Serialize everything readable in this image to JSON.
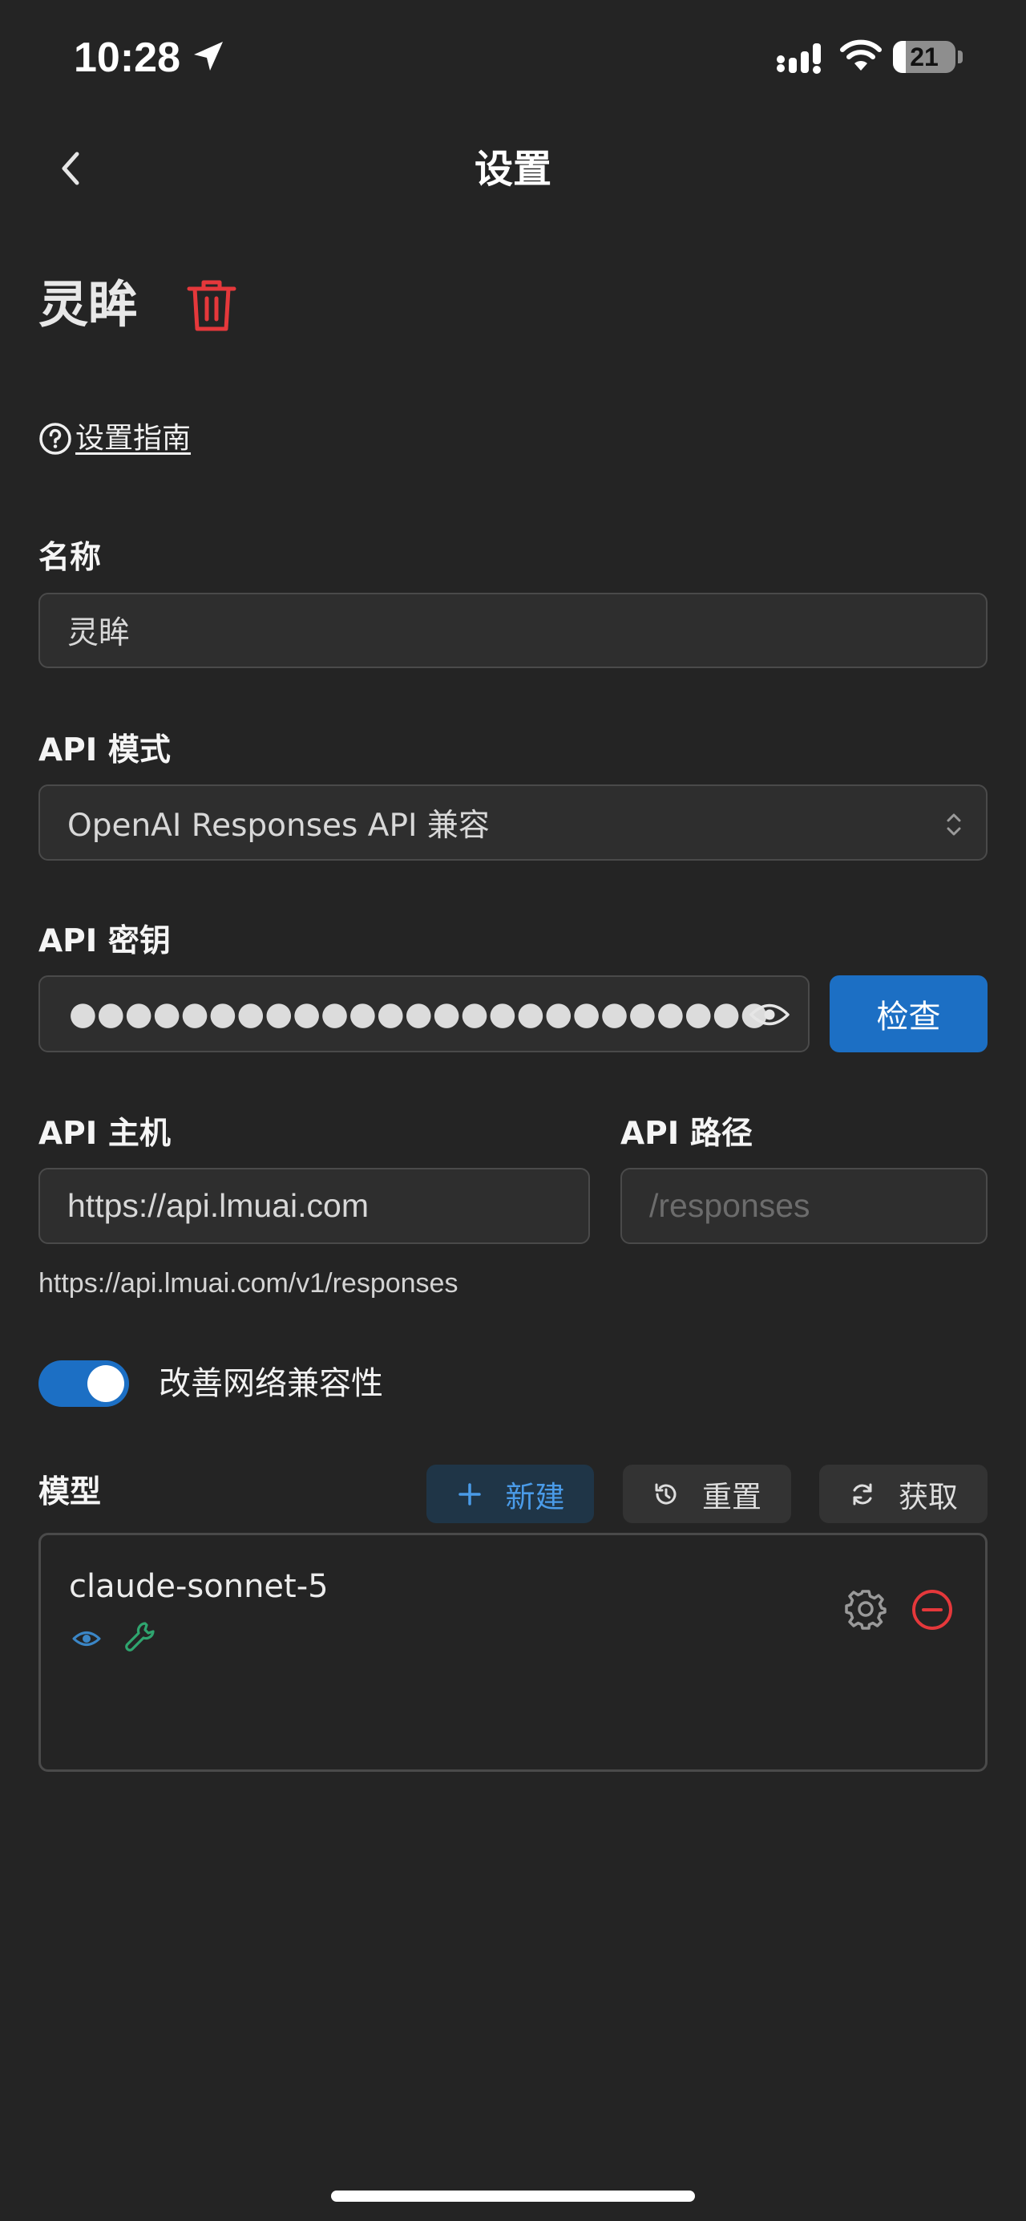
{
  "status_bar": {
    "time": "10:28",
    "battery_level": "21",
    "battery_fraction": 0.21
  },
  "nav": {
    "back_icon": "chevron-left-icon",
    "title": "设置"
  },
  "provider": {
    "name": "灵眸",
    "delete_icon": "trash-icon",
    "guide_icon": "question-circle-icon",
    "guide_text": "设置指南"
  },
  "form": {
    "name_label": "名称",
    "name_value": "灵眸",
    "api_mode_label": "API 模式",
    "api_mode_value": "OpenAI Responses API 兼容",
    "api_key_label": "API 密钥",
    "api_key_value": "●●●●●●●●●●●●●●●●●●●●●●●●●●●●●●●●●●",
    "check_button": "检查",
    "api_host_label": "API 主机",
    "api_host_value": "https://api.lmuai.com",
    "api_path_label": "API 路径",
    "api_path_placeholder": "/responses",
    "url_preview": "https://api.lmuai.com/v1/responses",
    "network_compat_label": "改善网络兼容性",
    "network_compat_enabled": true
  },
  "models": {
    "label": "模型",
    "new_button": "新建",
    "reset_button": "重置",
    "fetch_button": "获取",
    "items": [
      {
        "name": "claude-sonnet-5",
        "capabilities": [
          "vision",
          "tool-use"
        ]
      }
    ]
  },
  "colors": {
    "background": "#242424",
    "accent_blue": "#1c6fc4",
    "danger_red": "#e5383b",
    "tool_green": "#2fa56f",
    "vision_blue": "#3b86c6"
  }
}
